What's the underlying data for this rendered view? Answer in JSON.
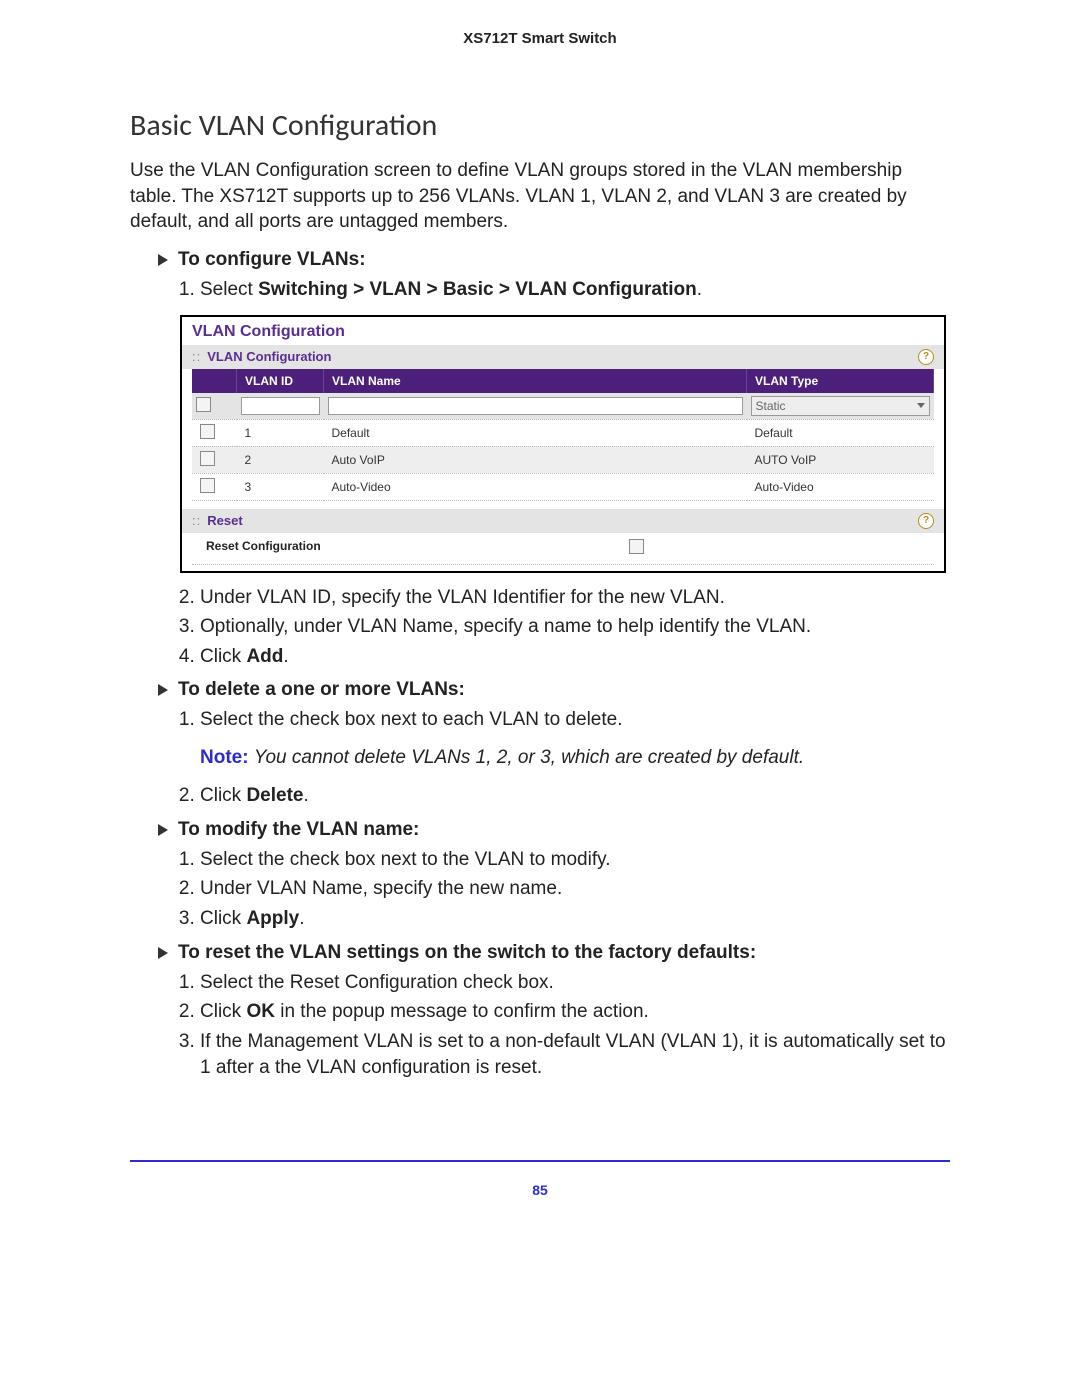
{
  "doc": {
    "header": "XS712T Smart Switch",
    "page_number": "85"
  },
  "title": "Basic VLAN Configuration",
  "intro": "Use the VLAN Configuration screen to define VLAN groups stored in the VLAN membership table. The XS712T supports up to 256 VLANs. VLAN 1, VLAN 2, and VLAN 3 are created by default, and all ports are untagged members.",
  "proc_configure": {
    "heading": "To configure VLANs:",
    "step1_pre": "Select ",
    "step1_path": "Switching > VLAN > Basic > VLAN Configuration",
    "step1_post": ".",
    "step2": "Under VLAN ID, specify the VLAN Identifier for the new VLAN.",
    "step3": "Optionally, under VLAN Name, specify a name to help identify the VLAN.",
    "step4_pre": "Click ",
    "step4_bold": "Add",
    "step4_post": "."
  },
  "ui": {
    "panel_title": "VLAN Configuration",
    "section_title": "VLAN Configuration",
    "columns": {
      "id": "VLAN ID",
      "name": "VLAN Name",
      "type": "VLAN Type"
    },
    "edit_row": {
      "type_value": "Static"
    },
    "rows": [
      {
        "id": "1",
        "name": "Default",
        "type": "Default"
      },
      {
        "id": "2",
        "name": "Auto VoIP",
        "type": "AUTO VoIP"
      },
      {
        "id": "3",
        "name": "Auto-Video",
        "type": "Auto-Video"
      }
    ],
    "reset_section": "Reset",
    "reset_label": "Reset Configuration"
  },
  "proc_delete": {
    "heading": "To delete a one or more VLANs:",
    "step1": "Select the check box next to each VLAN to delete.",
    "note_label": "Note:",
    "note_body": "You cannot delete VLANs 1, 2, or 3, which are created by default.",
    "step2_pre": "Click ",
    "step2_bold": "Delete",
    "step2_post": "."
  },
  "proc_modify": {
    "heading": "To modify the VLAN name:",
    "step1": "Select the check box next to the VLAN to modify.",
    "step2": "Under VLAN Name, specify the new name.",
    "step3_pre": "Click ",
    "step3_bold": "Apply",
    "step3_post": "."
  },
  "proc_reset": {
    "heading": "To reset the VLAN settings on the switch to the factory defaults:",
    "step1": "Select the Reset Configuration check box.",
    "step2_pre": "Click ",
    "step2_bold": "OK",
    "step2_post": " in the popup message to confirm the action.",
    "step3": "If the Management VLAN is set to a non-default VLAN (VLAN 1), it is automatically set to 1 after a the VLAN configuration is reset."
  }
}
